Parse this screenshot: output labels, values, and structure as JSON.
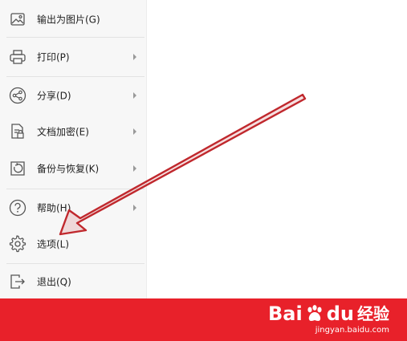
{
  "menu": {
    "items": [
      {
        "label": "输出为图片(G)",
        "icon": "export-image-icon",
        "submenu": false
      },
      {
        "label": "打印(P)",
        "icon": "printer-icon",
        "submenu": true
      },
      {
        "label": "分享(D)",
        "icon": "share-icon",
        "submenu": true
      },
      {
        "label": "文档加密(E)",
        "icon": "document-encrypt-icon",
        "submenu": true
      },
      {
        "label": "备份与恢复(K)",
        "icon": "backup-restore-icon",
        "submenu": true
      },
      {
        "label": "帮助(H)",
        "icon": "help-icon",
        "submenu": true
      },
      {
        "label": "选项(L)",
        "icon": "gear-icon",
        "submenu": false
      },
      {
        "label": "退出(Q)",
        "icon": "exit-icon",
        "submenu": false
      }
    ]
  },
  "annotation": {
    "arrow_color": "#c0282d",
    "icon": "red-arrow-pointer"
  },
  "watermark": {
    "logo_text": "Bai",
    "logo_text2": "du",
    "logo_cn": "经验",
    "url": "jingyan.baidu.com"
  },
  "colors": {
    "footer": "#e8212a",
    "panel": "#f7f7f7"
  }
}
